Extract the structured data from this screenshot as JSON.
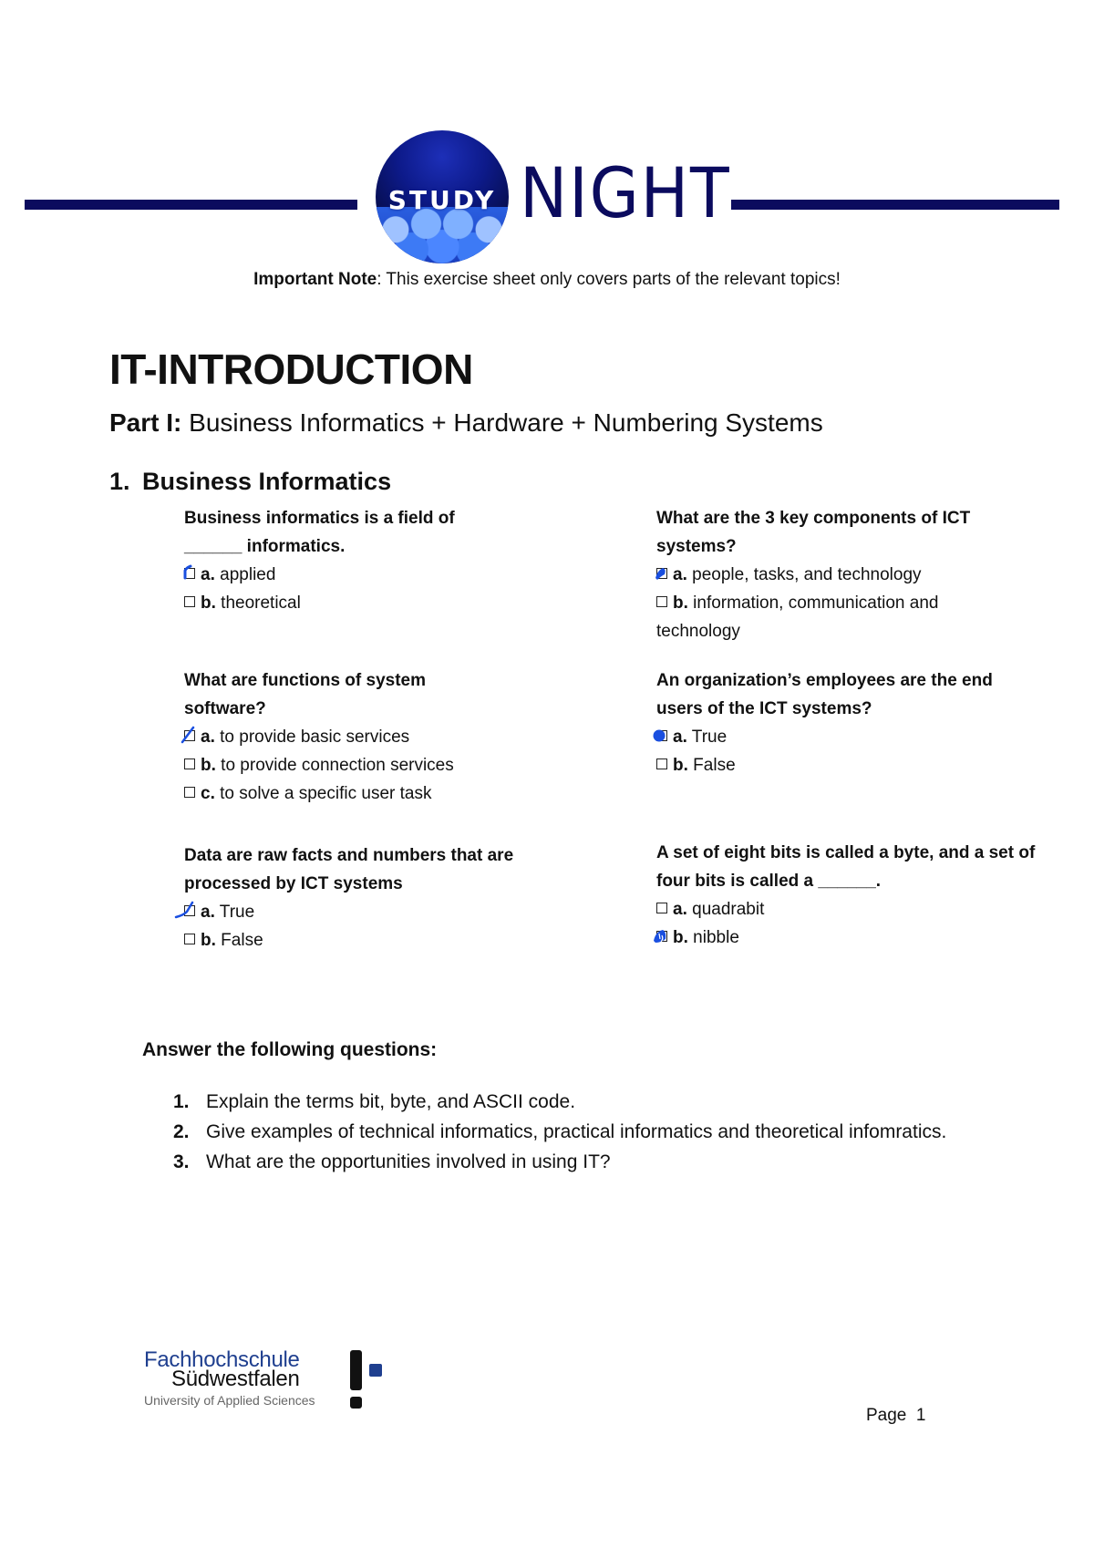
{
  "header": {
    "logo_word1": "STUDY",
    "logo_word2": "NIGHT",
    "note_label": "Important Note",
    "note_text": ": This exercise sheet only covers parts of the relevant topics!",
    "brand_color": "#0b0b5e"
  },
  "title": "IT-INTRODUCTION",
  "subtitle": {
    "label": "Part I:",
    "text": " Business Informatics + Hardware + Numbering Systems"
  },
  "section": {
    "number": "1.",
    "title": "Business Informatics"
  },
  "questions": [
    {
      "text": "Business informatics is a field of ______ informatics.",
      "options": [
        {
          "letter": "a.",
          "text": "applied",
          "marked": true
        },
        {
          "letter": "b.",
          "text": "theoretical",
          "marked": false
        }
      ]
    },
    {
      "text": "What are the 3 key components of ICT systems?",
      "options": [
        {
          "letter": "a.",
          "text": "people, tasks, and technology",
          "marked": true
        },
        {
          "letter": "b.",
          "text": "information, communication and technology",
          "marked": false
        }
      ]
    },
    {
      "text": "What are functions of system software?",
      "options": [
        {
          "letter": "a.",
          "text": "to provide basic services",
          "marked": true
        },
        {
          "letter": "b.",
          "text": "to provide connection services",
          "marked": false
        },
        {
          "letter": "c.",
          "text": "to solve a specific user task",
          "marked": false
        }
      ]
    },
    {
      "text": "An organization’s employees are the end users of the ICT systems?",
      "options": [
        {
          "letter": "a.",
          "text": "True",
          "marked": true
        },
        {
          "letter": "b.",
          "text": "False",
          "marked": false
        }
      ]
    },
    {
      "text": "Data are raw facts and numbers that are processed by ICT systems",
      "options": [
        {
          "letter": "a.",
          "text": "True",
          "marked": true
        },
        {
          "letter": "b.",
          "text": "False",
          "marked": false
        }
      ]
    },
    {
      "text": "A set of eight bits is called a byte, and a set of four bits is called a ______.",
      "options": [
        {
          "letter": "a.",
          "text": "quadrabit",
          "marked": false
        },
        {
          "letter": "b.",
          "text": "nibble",
          "marked": true
        }
      ]
    }
  ],
  "answer_section": {
    "heading": "Answer the following questions:",
    "items": [
      {
        "number": "1.",
        "text": "Explain the terms bit, byte, and ASCII code."
      },
      {
        "number": "2.",
        "text": "Give examples of technical informatics, practical informatics and theoretical infomratics."
      },
      {
        "number": "3.",
        "text": "What are the opportunities involved in using IT?"
      }
    ]
  },
  "footer": {
    "institution_line1": "Fachhochschule",
    "institution_line2": "Südwestfalen",
    "institution_line3": "University of Applied Sciences",
    "page_label": "Page  1",
    "institution_color": "#1f3f8f",
    "ink_color": "#1a4fe0"
  }
}
